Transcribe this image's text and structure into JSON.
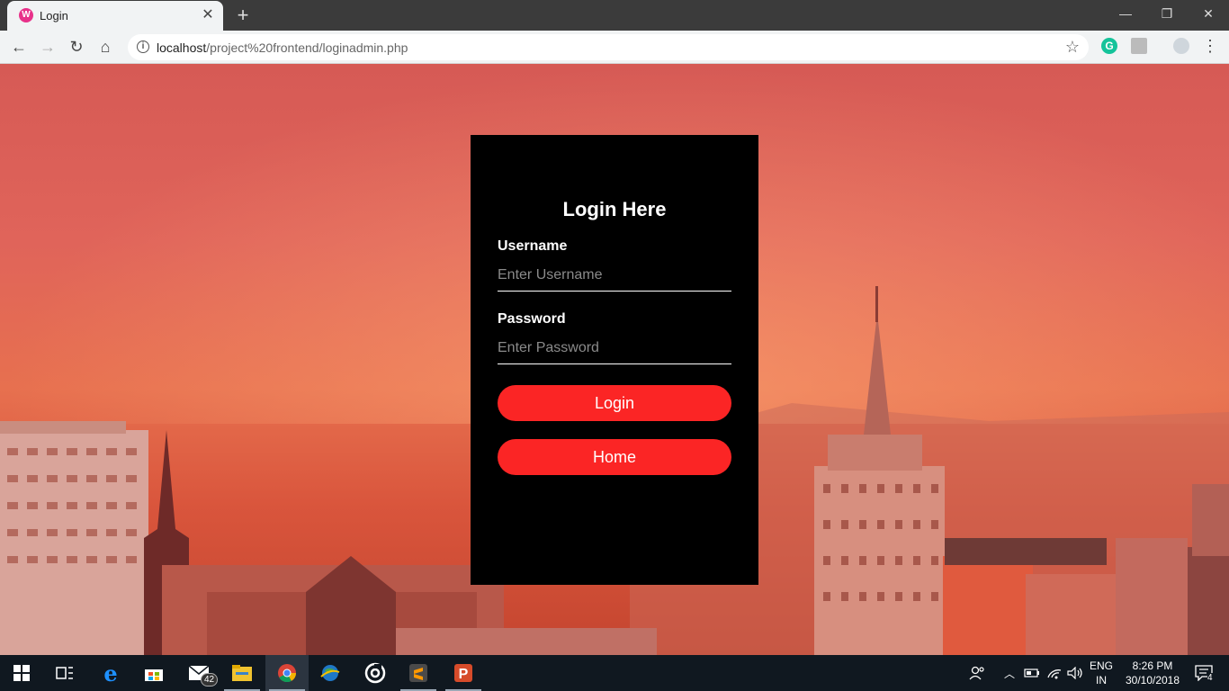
{
  "browser": {
    "tab": {
      "title": "Login",
      "favicon": "wamp-icon"
    },
    "url": {
      "host": "localhost",
      "path": "/project%20frontend/loginadmin.php"
    },
    "window_controls": [
      "minimize",
      "restore",
      "close"
    ]
  },
  "login": {
    "title": "Login Here",
    "username": {
      "label": "Username",
      "placeholder": "Enter Username",
      "value": ""
    },
    "password": {
      "label": "Password",
      "placeholder": "Enter Password",
      "value": ""
    },
    "login_button": "Login",
    "home_button": "Home",
    "accent_color": "#fb2525"
  },
  "taskbar": {
    "mail_badge": "42",
    "language": {
      "line1": "ENG",
      "line2": "IN"
    },
    "clock": {
      "time": "8:26 PM",
      "date": "30/10/2018"
    },
    "notifications_badge": "4",
    "apps": [
      "windows-start-icon",
      "task-view-icon",
      "edge-icon",
      "store-icon",
      "mail-icon",
      "file-explorer-icon",
      "chrome-icon",
      "globe-app-icon",
      "settings-ring-icon",
      "sublime-text-icon",
      "p-app-icon"
    ]
  }
}
